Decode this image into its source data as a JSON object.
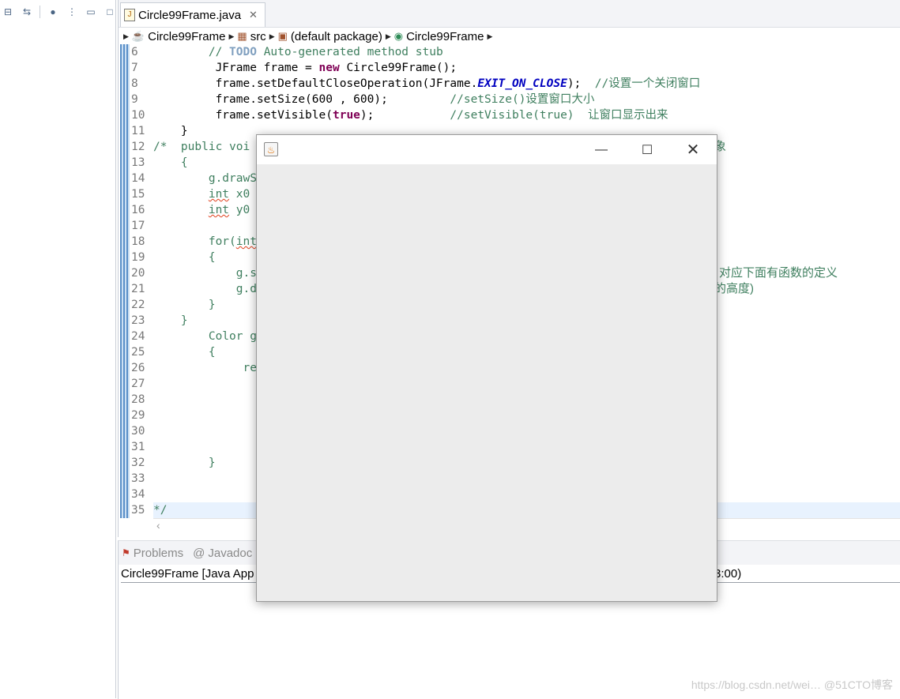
{
  "left_toolbar": {
    "icons": [
      "collapse-all-icon",
      "link-with-editor-icon",
      "focus-icon",
      "view-menu-icon",
      "minimize-icon",
      "maximize-icon"
    ]
  },
  "editor": {
    "tab_label": "Circle99Frame.java",
    "breadcrumb": [
      "Circle99Frame",
      "src",
      "(default package)",
      "Circle99Frame"
    ],
    "lines": [
      {
        "num": "6",
        "html": "        <span class=\"cm\">// <span class=\"todo\">TODO</span> Auto-generated method stub</span>"
      },
      {
        "num": "7",
        "html": "         JFrame frame = <span class=\"kw\">new</span> Circle99Frame();"
      },
      {
        "num": "8",
        "html": "         frame.setDefaultCloseOperation(JFrame.<span class=\"cst\">EXIT_ON_CLOSE</span>);  <span class=\"cm\">//设置一个关闭窗口</span>"
      },
      {
        "num": "9",
        "html": "         frame.setSize(600 , 600);         <span class=\"cm\">//setSize()设置窗口大小</span>"
      },
      {
        "num": "10",
        "html": "         frame.setVisible(<span class=\"kw\">true</span>);           <span class=\"cm\">//setVisible(true)  让窗口显示出来</span>"
      },
      {
        "num": "11",
        "html": "    }"
      },
      {
        "num": "12",
        "html": "<span class=\"cm\">/*  public voi</span>"
      },
      {
        "num": "13",
        "html": "<span class=\"cm\">    {</span>"
      },
      {
        "num": "14",
        "html": "<span class=\"cm\">        g.drawS</span>"
      },
      {
        "num": "15",
        "html": "<span class=\"cm\">        <span class=\"sq\">int</span> x0</span>"
      },
      {
        "num": "16",
        "html": "<span class=\"cm\">        <span class=\"sq\">int</span> y0</span>"
      },
      {
        "num": "17",
        "html": ""
      },
      {
        "num": "18",
        "html": "<span class=\"cm\">        for(<span class=\"sq\">int</span></span>"
      },
      {
        "num": "19",
        "html": "<span class=\"cm\">        {</span>"
      },
      {
        "num": "20",
        "html": "<span class=\"cm\">            g.s</span>"
      },
      {
        "num": "21",
        "html": "<span class=\"cm\">            g.d</span>"
      },
      {
        "num": "22",
        "html": "<span class=\"cm\">        }</span>"
      },
      {
        "num": "23",
        "html": "<span class=\"cm\">    }</span>"
      },
      {
        "num": "24",
        "html": "<span class=\"cm\">        Color g</span>"
      },
      {
        "num": "25",
        "html": "<span class=\"cm\">        {</span>"
      },
      {
        "num": "26",
        "html": "<span class=\"cm\">             re</span>"
      },
      {
        "num": "27",
        "html": ""
      },
      {
        "num": "28",
        "html": ""
      },
      {
        "num": "29",
        "html": ""
      },
      {
        "num": "30",
        "html": ""
      },
      {
        "num": "31",
        "html": ""
      },
      {
        "num": "32",
        "html": "<span class=\"cm\">        }</span>"
      },
      {
        "num": "33",
        "html": ""
      },
      {
        "num": "34",
        "html": ""
      },
      {
        "num": "35",
        "html": "<span class=\"cm\">*/</span>",
        "current": true
      }
    ],
    "trailing_fragments": [
      {
        "line": "12",
        "text": "象"
      },
      {
        "line": "20",
        "text": "对应下面有函数的定义"
      },
      {
        "line": "21",
        "text": "的高度)"
      }
    ]
  },
  "bottom_panel": {
    "tabs": [
      "Problems",
      "Javadoc"
    ],
    "console_title_left": "Circle99Frame [Java App",
    "console_title_right": "3:00)",
    "watermark": "https://blog.csdn.net/wei… @51CTO博客"
  },
  "jframe": {
    "title_icon": "java-cup-icon",
    "minimize": "—",
    "maximize": "☐",
    "close": "✕"
  }
}
